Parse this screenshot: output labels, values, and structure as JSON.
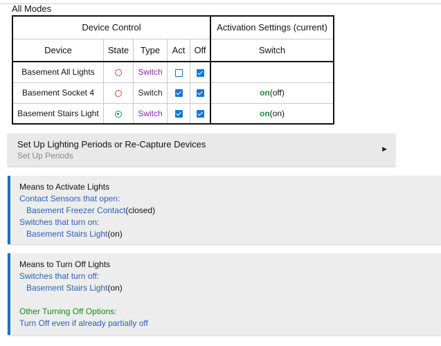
{
  "section_title": "All Modes",
  "table": {
    "group_device_control": "Device Control",
    "group_activation": "Activation Settings (current)",
    "columns": [
      "Device",
      "State",
      "Type",
      "Act",
      "Off",
      "Switch"
    ],
    "rows": [
      {
        "device": "Basement All Lights",
        "state": "off",
        "type": "Switch",
        "type_style": "link",
        "act": false,
        "off": true,
        "switch_on": "",
        "switch_cur": ""
      },
      {
        "device": "Basement Socket 4",
        "state": "off",
        "type": "Switch",
        "type_style": "plain",
        "act": true,
        "off": true,
        "switch_on": "on",
        "switch_cur": "(off)"
      },
      {
        "device": "Basement Stairs Light",
        "state": "on",
        "type": "Switch",
        "type_style": "link",
        "act": true,
        "off": true,
        "switch_on": "on",
        "switch_cur": "(on)"
      }
    ]
  },
  "setup_panel": {
    "title": "Set Up Lighting Periods or Re-Capture Devices",
    "subtitle": "Set Up Periods",
    "arrow": "▶"
  },
  "activate_box": {
    "heading": "Means to Activate Lights",
    "contact_label": "Contact Sensors that open:",
    "contact_device": "Basement Freezer Contact",
    "contact_state": "(closed)",
    "switch_label": "Switches that turn on:",
    "switch_device": "Basement Stairs Light",
    "switch_state": "(on)"
  },
  "turnoff_box": {
    "heading": "Means to Turn Off Lights",
    "switch_label": "Switches that turn off:",
    "switch_device": "Basement Stairs Light",
    "switch_state": "(on)",
    "other_label": "Other Turning Off Options:",
    "other_option": "Turn Off even if already partially off"
  },
  "colors": {
    "accent_blue": "#1e73be",
    "link_blue": "#2962b8",
    "purple": "#8e24aa",
    "green": "#1e8e3e",
    "red": "#e53935"
  }
}
